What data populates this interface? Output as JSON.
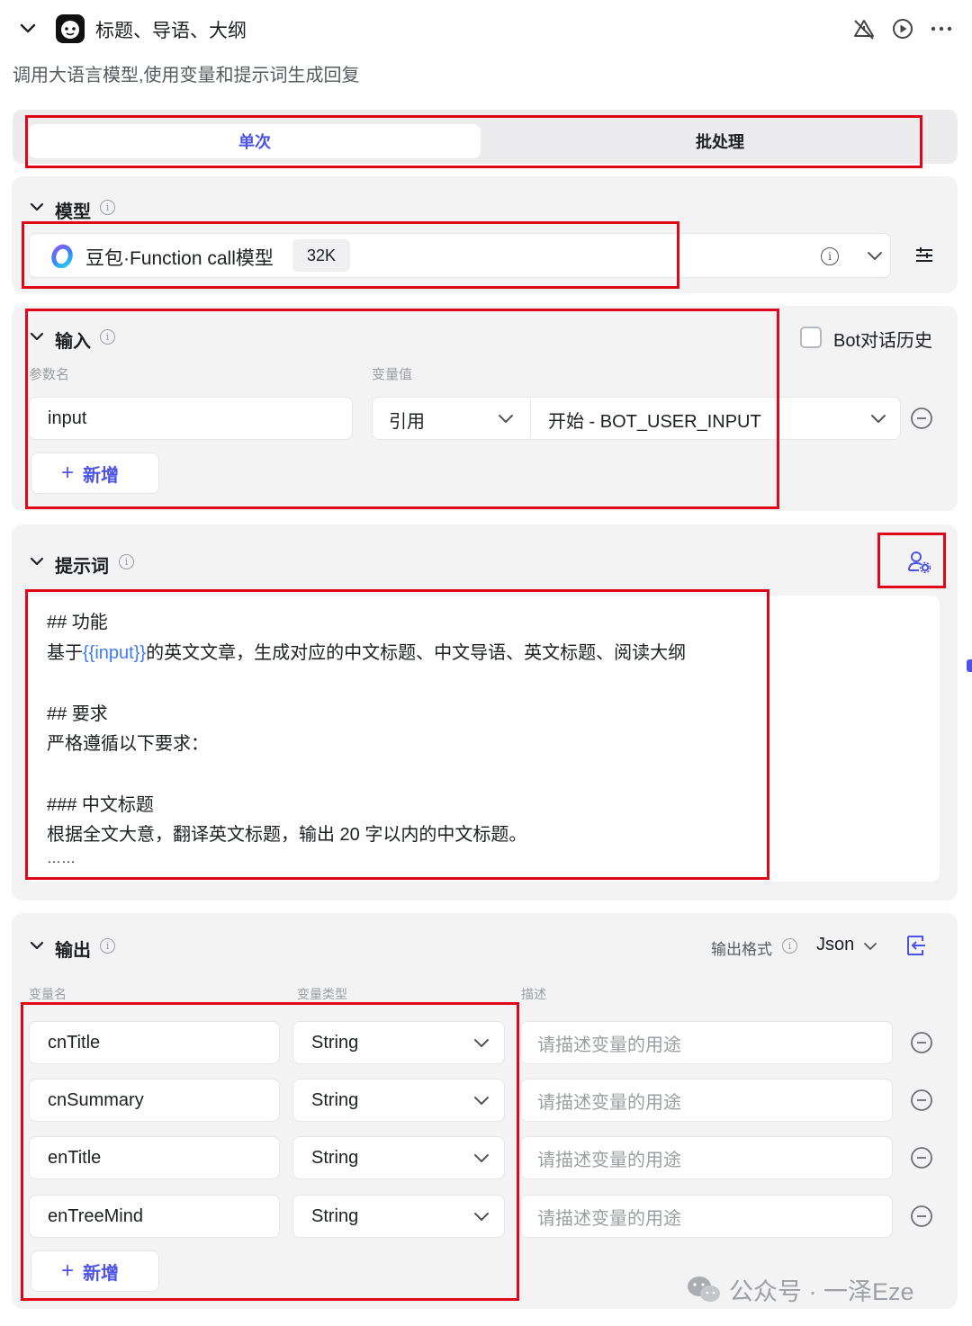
{
  "header": {
    "title": "标题、导语、大纲",
    "description": "调用大语言模型,使用变量和提示词生成回复"
  },
  "tabs": [
    {
      "label": "单次",
      "active": true
    },
    {
      "label": "批处理",
      "active": false
    }
  ],
  "model_section": {
    "title": "模型",
    "model_name": "豆包·Function call模型",
    "context_badge": "32K"
  },
  "input_section": {
    "title": "输入",
    "history_label": "Bot对话历史",
    "history_checked": false,
    "col_param": "参数名",
    "col_value": "变量值",
    "rows": [
      {
        "name": "input",
        "type": "引用",
        "value": "开始 - BOT_USER_INPUT"
      }
    ],
    "add_label": "新增"
  },
  "prompt_section": {
    "title": "提示词",
    "lines": {
      "l1": "## 功能",
      "l2_pre": "基于",
      "l2_var": "{{input}}",
      "l2_post": "的英文文章，生成对应的中文标题、中文导语、英文标题、阅读大纲",
      "l3": "## 要求",
      "l4": "严格遵循以下要求：",
      "l5": "### 中文标题",
      "l6": "根据全文大意，翻译英文标题，输出 20 字以内的中文标题。",
      "l7": "……"
    }
  },
  "output_section": {
    "title": "输出",
    "format_label": "输出格式",
    "format_value": "Json",
    "col_name": "变量名",
    "col_type": "变量类型",
    "col_desc": "描述",
    "rows": [
      {
        "name": "cnTitle",
        "type": "String",
        "placeholder": "请描述变量的用途"
      },
      {
        "name": "cnSummary",
        "type": "String",
        "placeholder": "请描述变量的用途"
      },
      {
        "name": "enTitle",
        "type": "String",
        "placeholder": "请描述变量的用途"
      },
      {
        "name": "enTreeMind",
        "type": "String",
        "placeholder": "请描述变量的用途"
      }
    ],
    "add_label": "新增"
  },
  "watermark": "公众号 · 一泽Eze",
  "colors": {
    "accent": "#4d53e8",
    "highlight_box": "#e0061a",
    "variable": "#3e7bf5"
  }
}
